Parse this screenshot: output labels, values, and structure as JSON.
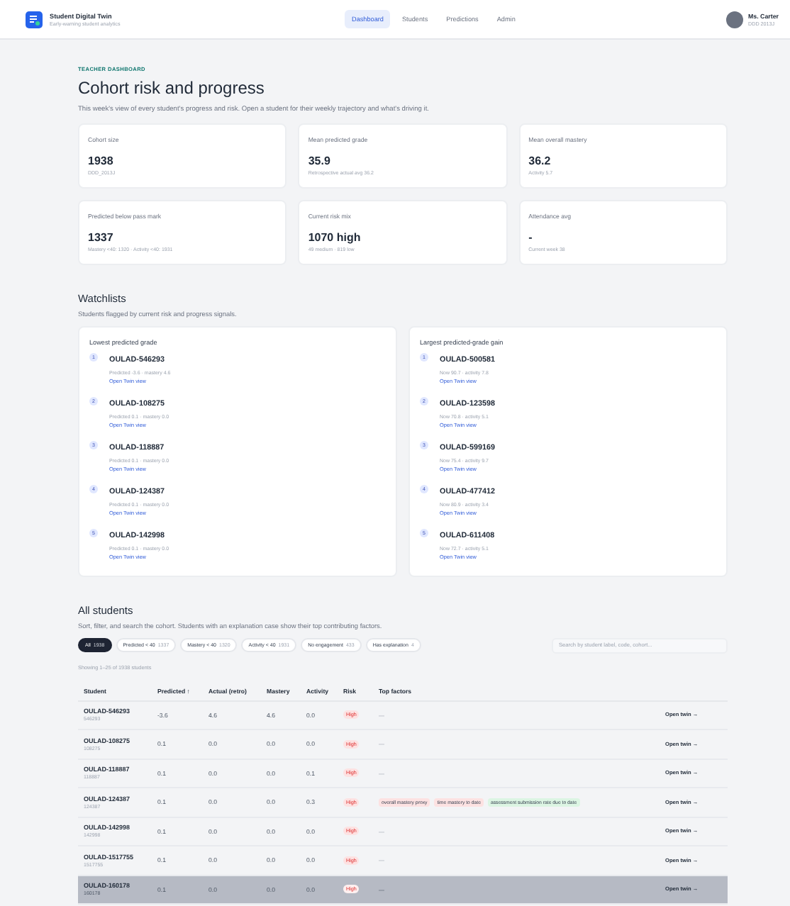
{
  "app": {
    "name": "Student Digital Twin",
    "tagline": "Early-warning student analytics"
  },
  "nav": [
    {
      "label": "Dashboard",
      "selected": true
    },
    {
      "label": "Students",
      "selected": false
    },
    {
      "label": "Predictions",
      "selected": false
    },
    {
      "label": "Admin",
      "selected": false
    }
  ],
  "user": {
    "name": "Ms. Carter",
    "cohort": "DDD 2013J"
  },
  "page": {
    "eyebrow": "TEACHER DASHBOARD",
    "title": "Cohort risk and progress",
    "description": "This week's view of every student's progress and risk. Open a student for their weekly trajectory and what's driving it."
  },
  "stats": [
    {
      "label": "Cohort size",
      "value": "1938",
      "note": "DDD_2013J"
    },
    {
      "label": "Mean predicted grade",
      "value": "35.9",
      "note": "Retrospective actual avg 36.2"
    },
    {
      "label": "Mean overall mastery",
      "value": "36.2",
      "note": "Activity 5.7"
    },
    {
      "label": "Predicted below pass mark",
      "value": "1337",
      "note": "Mastery <40: 1320 · Activity <40: 1931"
    },
    {
      "label": "Current risk mix",
      "value": "1070 high",
      "note": "49 medium · 819 low"
    },
    {
      "label": "Attendance avg",
      "value": "-",
      "note": "Current week 38"
    }
  ],
  "watchlists": {
    "title": "Watchlists",
    "subtitle": "Students flagged by current risk and progress signals.",
    "lists": [
      {
        "title": "Lowest predicted grade",
        "items": [
          {
            "rank": "1",
            "student": "OULAD-546293",
            "detail": "Predicted -3.6 · mastery 4.6",
            "link": "Open Twin view"
          },
          {
            "rank": "2",
            "student": "OULAD-108275",
            "detail": "Predicted 0.1 · mastery 0.0",
            "link": "Open Twin view"
          },
          {
            "rank": "3",
            "student": "OULAD-118887",
            "detail": "Predicted 0.1 · mastery 0.0",
            "link": "Open Twin view"
          },
          {
            "rank": "4",
            "student": "OULAD-124387",
            "detail": "Predicted 0.1 · mastery 0.0",
            "link": "Open Twin view"
          },
          {
            "rank": "5",
            "student": "OULAD-142998",
            "detail": "Predicted 0.1 · mastery 0.0",
            "link": "Open Twin view"
          }
        ]
      },
      {
        "title": "Largest predicted-grade gain",
        "items": [
          {
            "rank": "1",
            "student": "OULAD-500581",
            "detail": "Now 90.7 · activity 7.8",
            "link": "Open Twin view"
          },
          {
            "rank": "2",
            "student": "OULAD-123598",
            "detail": "Now 70.8 · activity 5.1",
            "link": "Open Twin view"
          },
          {
            "rank": "3",
            "student": "OULAD-599169",
            "detail": "Now 75.4 · activity 9.7",
            "link": "Open Twin view"
          },
          {
            "rank": "4",
            "student": "OULAD-477412",
            "detail": "Now 80.9 · activity 3.4",
            "link": "Open Twin view"
          },
          {
            "rank": "5",
            "student": "OULAD-611408",
            "detail": "Now 72.7 · activity 5.1",
            "link": "Open Twin view"
          }
        ]
      }
    ]
  },
  "all_students": {
    "title": "All students",
    "subtitle": "Sort, filter, and search the cohort. Students with an explanation case show their top contributing factors.",
    "filters": [
      {
        "label": "All",
        "count": "1938",
        "selected": true
      },
      {
        "label": "Predicted < 40",
        "count": "1337",
        "selected": false
      },
      {
        "label": "Mastery < 40",
        "count": "1320",
        "selected": false
      },
      {
        "label": "Activity < 40",
        "count": "1931",
        "selected": false
      },
      {
        "label": "No engagement",
        "count": "433",
        "selected": false
      },
      {
        "label": "Has explanation",
        "count": "4",
        "selected": false
      }
    ],
    "search": {
      "placeholder": "Search by student label, code, cohort..."
    },
    "showing": "Showing 1–25 of 1938 students",
    "columns": [
      "Student",
      "Predicted ↑",
      "Actual (retro)",
      "Mastery",
      "Activity",
      "Risk",
      "Top factors"
    ],
    "rows": [
      {
        "student": "OULAD-546293",
        "code": "546293",
        "predicted": "-3.6",
        "actual": "4.6",
        "mastery": "4.6",
        "activity": "0.0",
        "risk": "High",
        "factors": [],
        "empty": "—",
        "action": "Open twin →",
        "selected": false
      },
      {
        "student": "OULAD-108275",
        "code": "108275",
        "predicted": "0.1",
        "actual": "0.0",
        "mastery": "0.0",
        "activity": "0.0",
        "risk": "High",
        "factors": [],
        "empty": "—",
        "action": "Open twin →",
        "selected": false
      },
      {
        "student": "OULAD-118887",
        "code": "118887",
        "predicted": "0.1",
        "actual": "0.0",
        "mastery": "0.0",
        "activity": "0.1",
        "risk": "High",
        "factors": [],
        "empty": "—",
        "action": "Open twin →",
        "selected": false
      },
      {
        "student": "OULAD-124387",
        "code": "124387",
        "predicted": "0.1",
        "actual": "0.0",
        "mastery": "0.0",
        "activity": "0.3",
        "risk": "High",
        "factors": [
          {
            "label": "overall mastery proxy",
            "color": "#fde2e2"
          },
          {
            "label": "time mastery to date",
            "color": "#fde2e2"
          },
          {
            "label": "assessment submission rate due to date",
            "color": "#dcf5e3"
          }
        ],
        "action": "Open twin →",
        "selected": false
      },
      {
        "student": "OULAD-142998",
        "code": "142998",
        "predicted": "0.1",
        "actual": "0.0",
        "mastery": "0.0",
        "activity": "0.0",
        "risk": "High",
        "factors": [],
        "empty": "—",
        "action": "Open twin →",
        "selected": false
      },
      {
        "student": "OULAD-1517755",
        "code": "1517755",
        "predicted": "0.1",
        "actual": "0.0",
        "mastery": "0.0",
        "activity": "0.0",
        "risk": "High",
        "factors": [],
        "empty": "—",
        "action": "Open twin →",
        "selected": false
      },
      {
        "student": "OULAD-160178",
        "code": "160178",
        "predicted": "0.1",
        "actual": "0.0",
        "mastery": "0.0",
        "activity": "0.0",
        "risk": "High",
        "factors": [],
        "empty": "—",
        "action": "Open twin →",
        "selected": true
      }
    ]
  }
}
